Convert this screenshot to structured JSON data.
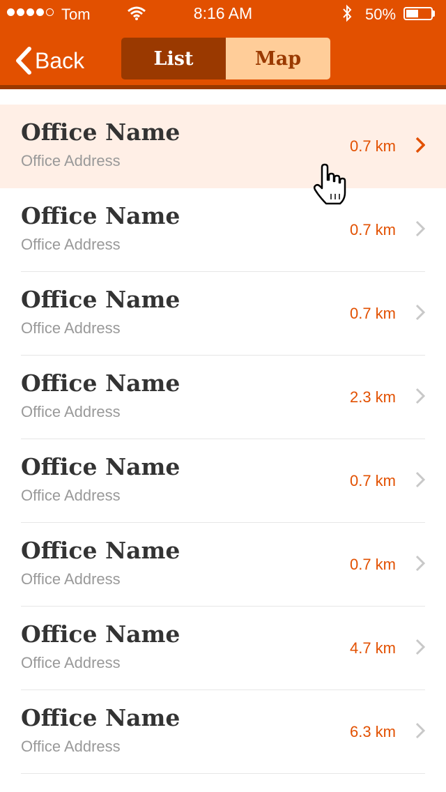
{
  "status_bar": {
    "carrier": "Tom",
    "time": "8:16 AM",
    "battery": "50%",
    "battery_level": 0.5,
    "signal_bars": 4
  },
  "nav": {
    "back_label": "Back",
    "segments": [
      {
        "label": "List",
        "active": true
      },
      {
        "label": "Map",
        "active": false
      }
    ]
  },
  "colors": {
    "accent": "#e25000",
    "accent_dark": "#9a3900",
    "segment_inactive": "#ffcd99",
    "highlight": "#ffefe6"
  },
  "offices": [
    {
      "name": "Office Name",
      "address": "Office Address",
      "distance": "0.7 km",
      "highlighted": true
    },
    {
      "name": "Office Name",
      "address": "Office Address",
      "distance": "0.7 km"
    },
    {
      "name": "Office Name",
      "address": "Office Address",
      "distance": "0.7 km"
    },
    {
      "name": "Office Name",
      "address": "Office Address",
      "distance": "2.3 km"
    },
    {
      "name": "Office Name",
      "address": "Office Address",
      "distance": "0.7 km"
    },
    {
      "name": "Office Name",
      "address": "Office Address",
      "distance": "0.7 km"
    },
    {
      "name": "Office Name",
      "address": "Office Address",
      "distance": "4.7 km"
    },
    {
      "name": "Office Name",
      "address": "Office Address",
      "distance": "6.3 km"
    }
  ]
}
